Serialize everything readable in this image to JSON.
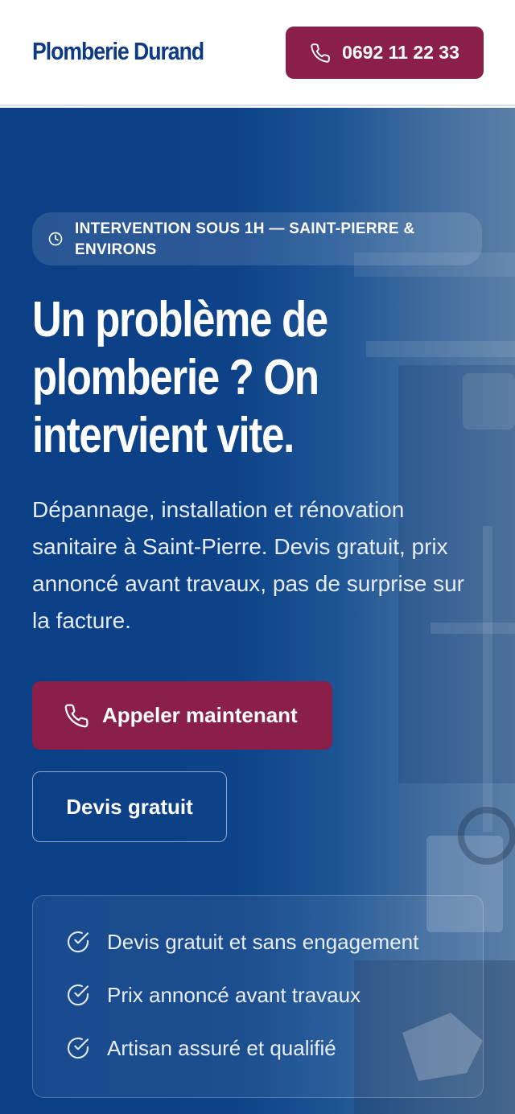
{
  "header": {
    "logo": "Plomberie Durand",
    "call_label": "0692 11 22 33",
    "call_icon": "phone-icon"
  },
  "hero": {
    "badge": {
      "icon": "clock-icon",
      "text": "INTERVENTION SOUS 1H — SAINT-PIERRE & ENVIRONS"
    },
    "title": "Un problème de plomberie ? On intervient vite.",
    "subtitle": "Dépannage, installation et rénovation sanitaire à Saint-Pierre. Devis gratuit, prix annoncé avant travaux, pas de surprise sur la facture.",
    "cta_primary": {
      "icon": "phone-icon",
      "label": "Appeler maintenant"
    },
    "cta_secondary": {
      "label": "Devis gratuit"
    },
    "features": [
      {
        "icon": "check-circle-icon",
        "label": "Devis gratuit et sans engagement"
      },
      {
        "icon": "check-circle-icon",
        "label": "Prix annoncé avant travaux"
      },
      {
        "icon": "check-circle-icon",
        "label": "Artisan assuré et qualifié"
      }
    ]
  },
  "colors": {
    "brand_blue": "#0d3a80",
    "hero_blue": "#0b3f86",
    "accent_burgundy": "#8a1f4a",
    "header_bg": "#ffffff"
  }
}
